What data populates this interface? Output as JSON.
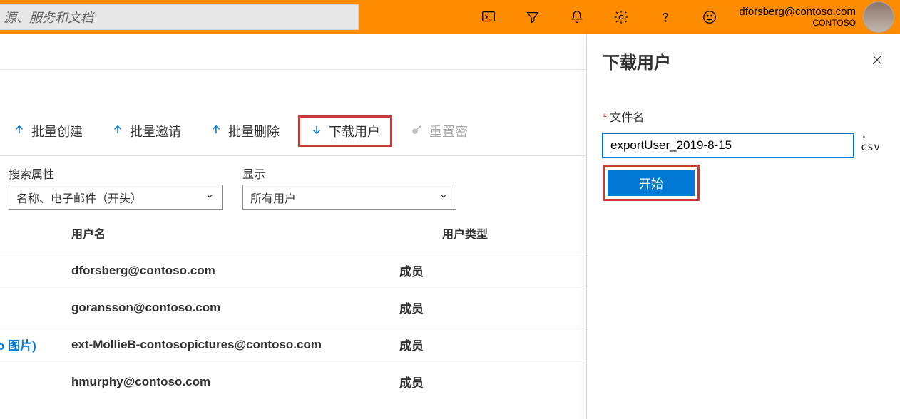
{
  "topbar": {
    "search_placeholder": "源、服务和文档",
    "user_email": "dforsberg@contoso.com",
    "tenant": "CONTOSO"
  },
  "toolbar": {
    "bulk_create": "批量创建",
    "bulk_invite": "批量邀请",
    "bulk_delete": "批量删除",
    "download_users": "下载用户",
    "reset_password": "重置密"
  },
  "filters": {
    "search_attr_label": "搜索属性",
    "search_attr_value": "名称、电子邮件（开头）",
    "display_label": "显示",
    "display_value": "所有用户"
  },
  "table": {
    "col_user": "用户名",
    "col_type": "用户类型",
    "rows": [
      {
        "user": "dforsberg@contoso.com",
        "type": "成员",
        "prefix": ""
      },
      {
        "user": "goransson@contoso.com",
        "type": "成员",
        "prefix": ""
      },
      {
        "user": "ext-MollieB-contosopictures@contoso.com",
        "type": "成员",
        "prefix": "o 图片)"
      },
      {
        "user": "hmurphy@contoso.com",
        "type": "成员",
        "prefix": ""
      }
    ]
  },
  "panel": {
    "title": "下载用户",
    "filename_label": "文件名",
    "filename_value": "exportUser_2019-8-15",
    "extension": ". csv",
    "start_label": "开始"
  }
}
